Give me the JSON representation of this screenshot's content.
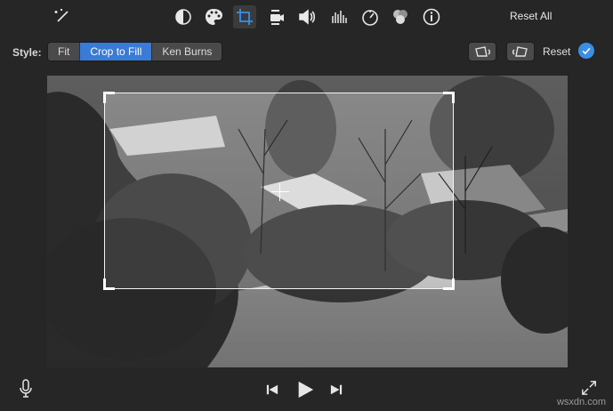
{
  "toolbar": {
    "icons": [
      "magic-wand-icon",
      "color-balance-icon",
      "color-palette-icon",
      "crop-icon",
      "camera-stabilization-icon",
      "volume-icon",
      "equalizer-icon",
      "speed-icon",
      "noise-reduction-icon",
      "info-icon"
    ],
    "active_icon": "crop-icon",
    "reset_all_label": "Reset All"
  },
  "style_row": {
    "label": "Style:",
    "options": [
      "Fit",
      "Crop to Fill",
      "Ken Burns"
    ],
    "selected": "Crop to Fill",
    "rotate_left_icon": "rotate-left-icon",
    "rotate_right_icon": "rotate-right-icon",
    "reset_label": "Reset",
    "apply_icon": "checkmark-icon"
  },
  "controls": {
    "mic_icon": "microphone-icon",
    "prev_icon": "skip-back-icon",
    "play_icon": "play-icon",
    "next_icon": "skip-forward-icon",
    "fullscreen_icon": "fullscreen-icon"
  },
  "watermark": "wsxdn.com",
  "colors": {
    "background": "#262626",
    "accent": "#3a7bd5",
    "apply": "#3a8ee6"
  }
}
